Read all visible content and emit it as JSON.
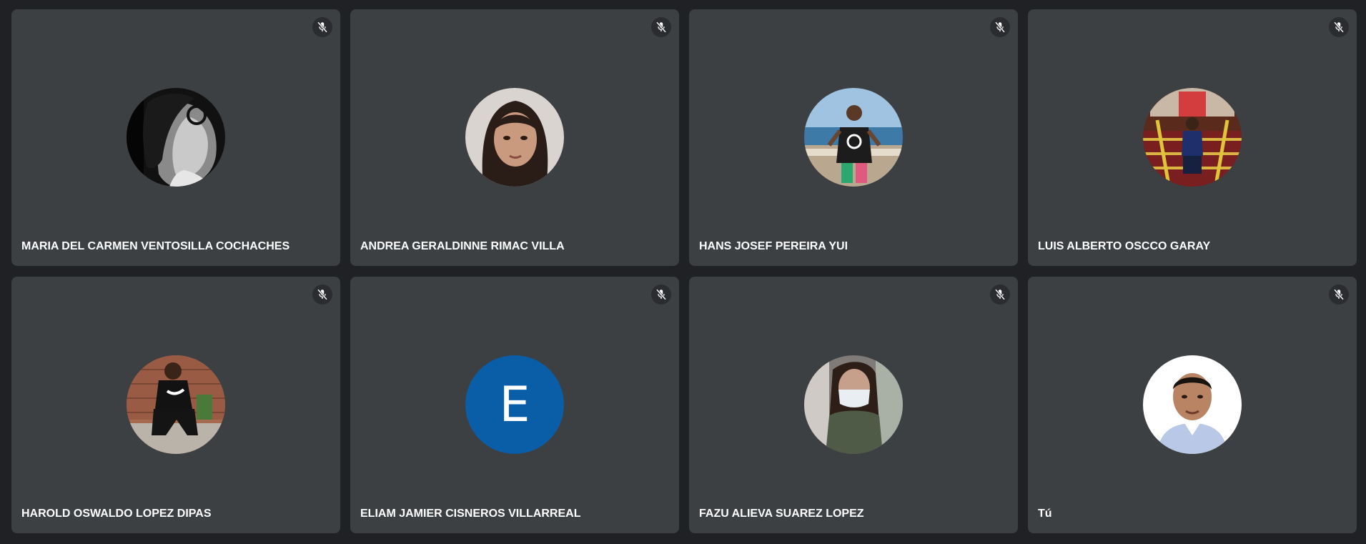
{
  "participants": [
    {
      "name": "MARIA DEL CARMEN VENTOSILLA COCHACHES",
      "mic": "mic-off-icon",
      "avatar": "photo"
    },
    {
      "name": "ANDREA GERALDINNE RIMAC VILLA",
      "mic": "mic-off-icon",
      "avatar": "photo"
    },
    {
      "name": "HANS JOSEF PEREIRA YUI",
      "mic": "mic-off-icon",
      "avatar": "photo"
    },
    {
      "name": "LUIS ALBERTO OSCCO GARAY",
      "mic": "mic-off-icon",
      "avatar": "photo"
    },
    {
      "name": "HAROLD OSWALDO LOPEZ DIPAS",
      "mic": "mic-off-icon",
      "avatar": "photo"
    },
    {
      "name": "ELIAM JAMIER CISNEROS VILLARREAL",
      "mic": "mic-off-icon",
      "avatar": "initial",
      "initial": "E",
      "avatar_color": "#0a5ea8"
    },
    {
      "name": "FAZU ALIEVA SUAREZ LOPEZ",
      "mic": "mic-off-icon",
      "avatar": "photo"
    },
    {
      "name": "Tú",
      "mic": "mic-off-icon",
      "avatar": "photo"
    }
  ],
  "colors": {
    "background": "#202124",
    "tile": "#3c4043",
    "text": "#ffffff"
  }
}
